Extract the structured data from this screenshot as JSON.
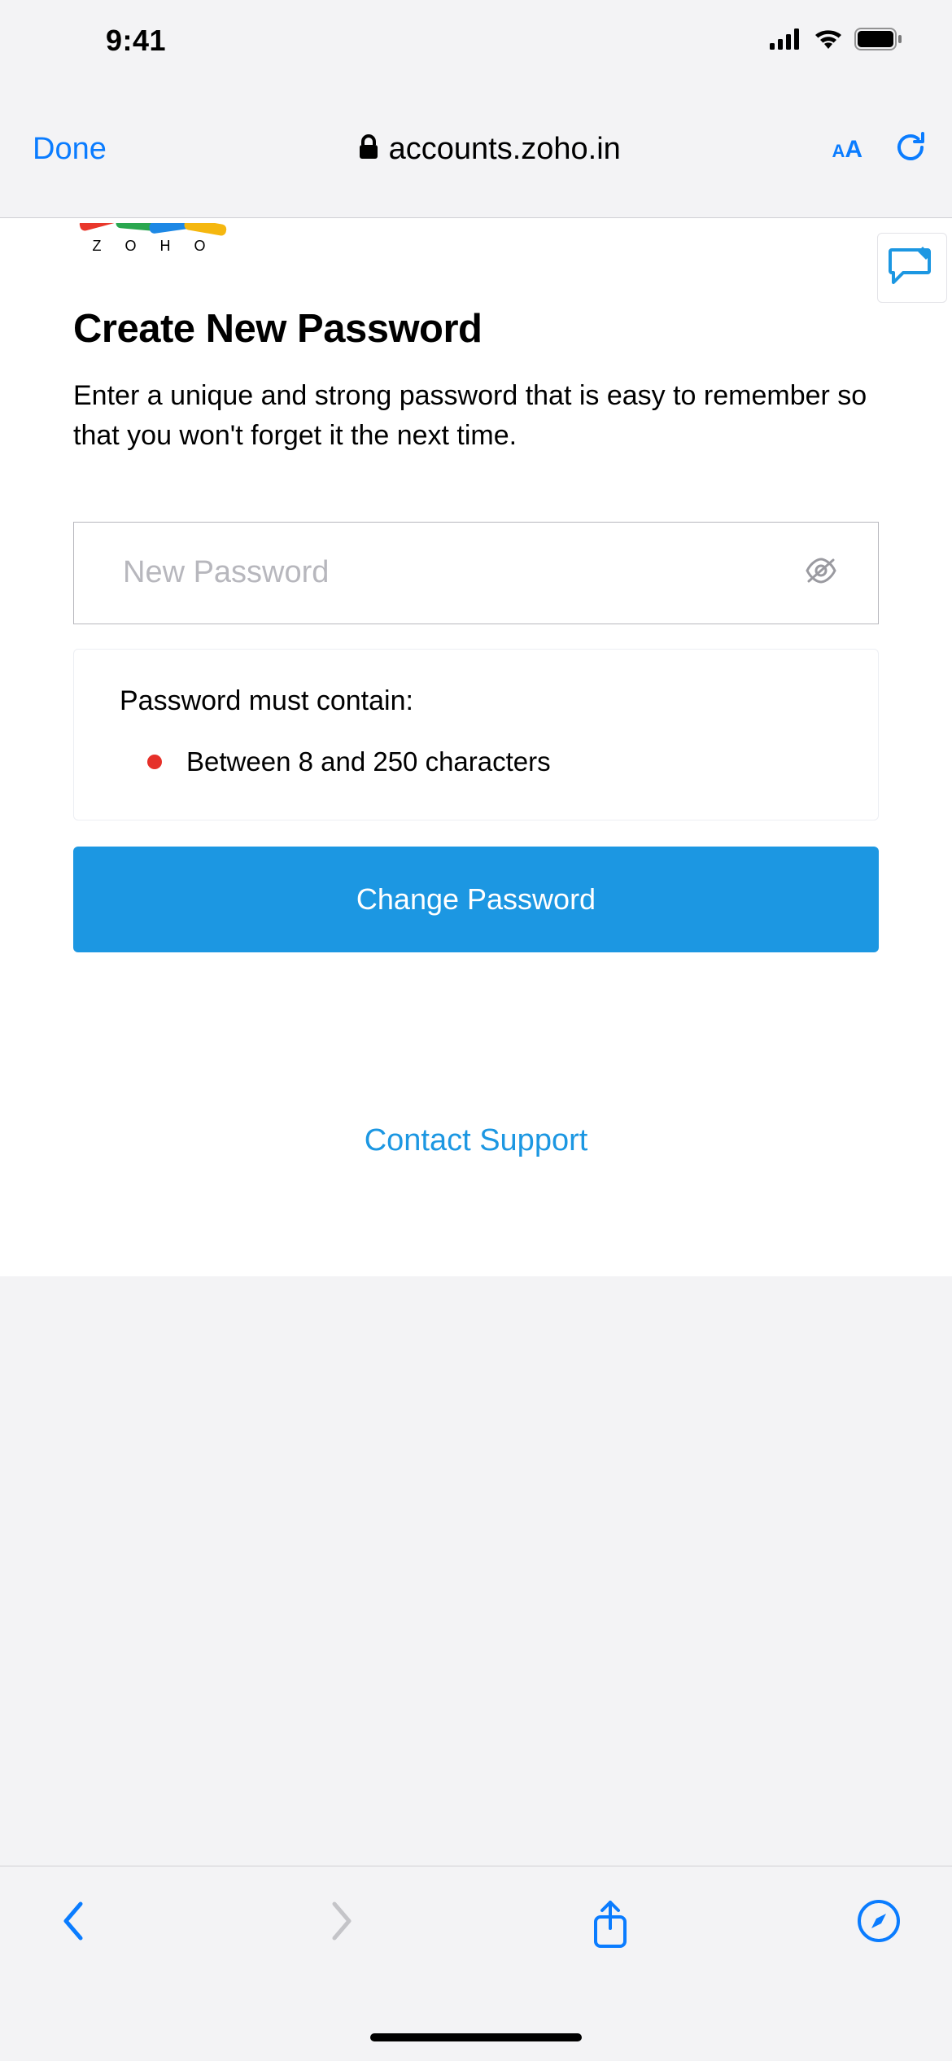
{
  "status": {
    "time": "9:41"
  },
  "browser": {
    "done_label": "Done",
    "url_host": "accounts.zoho.in"
  },
  "page": {
    "logo_text": "Z O H O",
    "title": "Create New Password",
    "subtitle": "Enter a unique and strong password that is easy to remember so that you won't forget it the next time.",
    "password_placeholder": "New Password",
    "password_value": "",
    "requirements_title": "Password must contain:",
    "requirements": [
      {
        "status": "fail",
        "text": "Between 8 and 250 characters"
      }
    ],
    "submit_label": "Change Password",
    "contact_label": "Contact Support"
  },
  "colors": {
    "accent": "#1c97e2",
    "link": "#0a7cff",
    "error": "#e63029"
  }
}
